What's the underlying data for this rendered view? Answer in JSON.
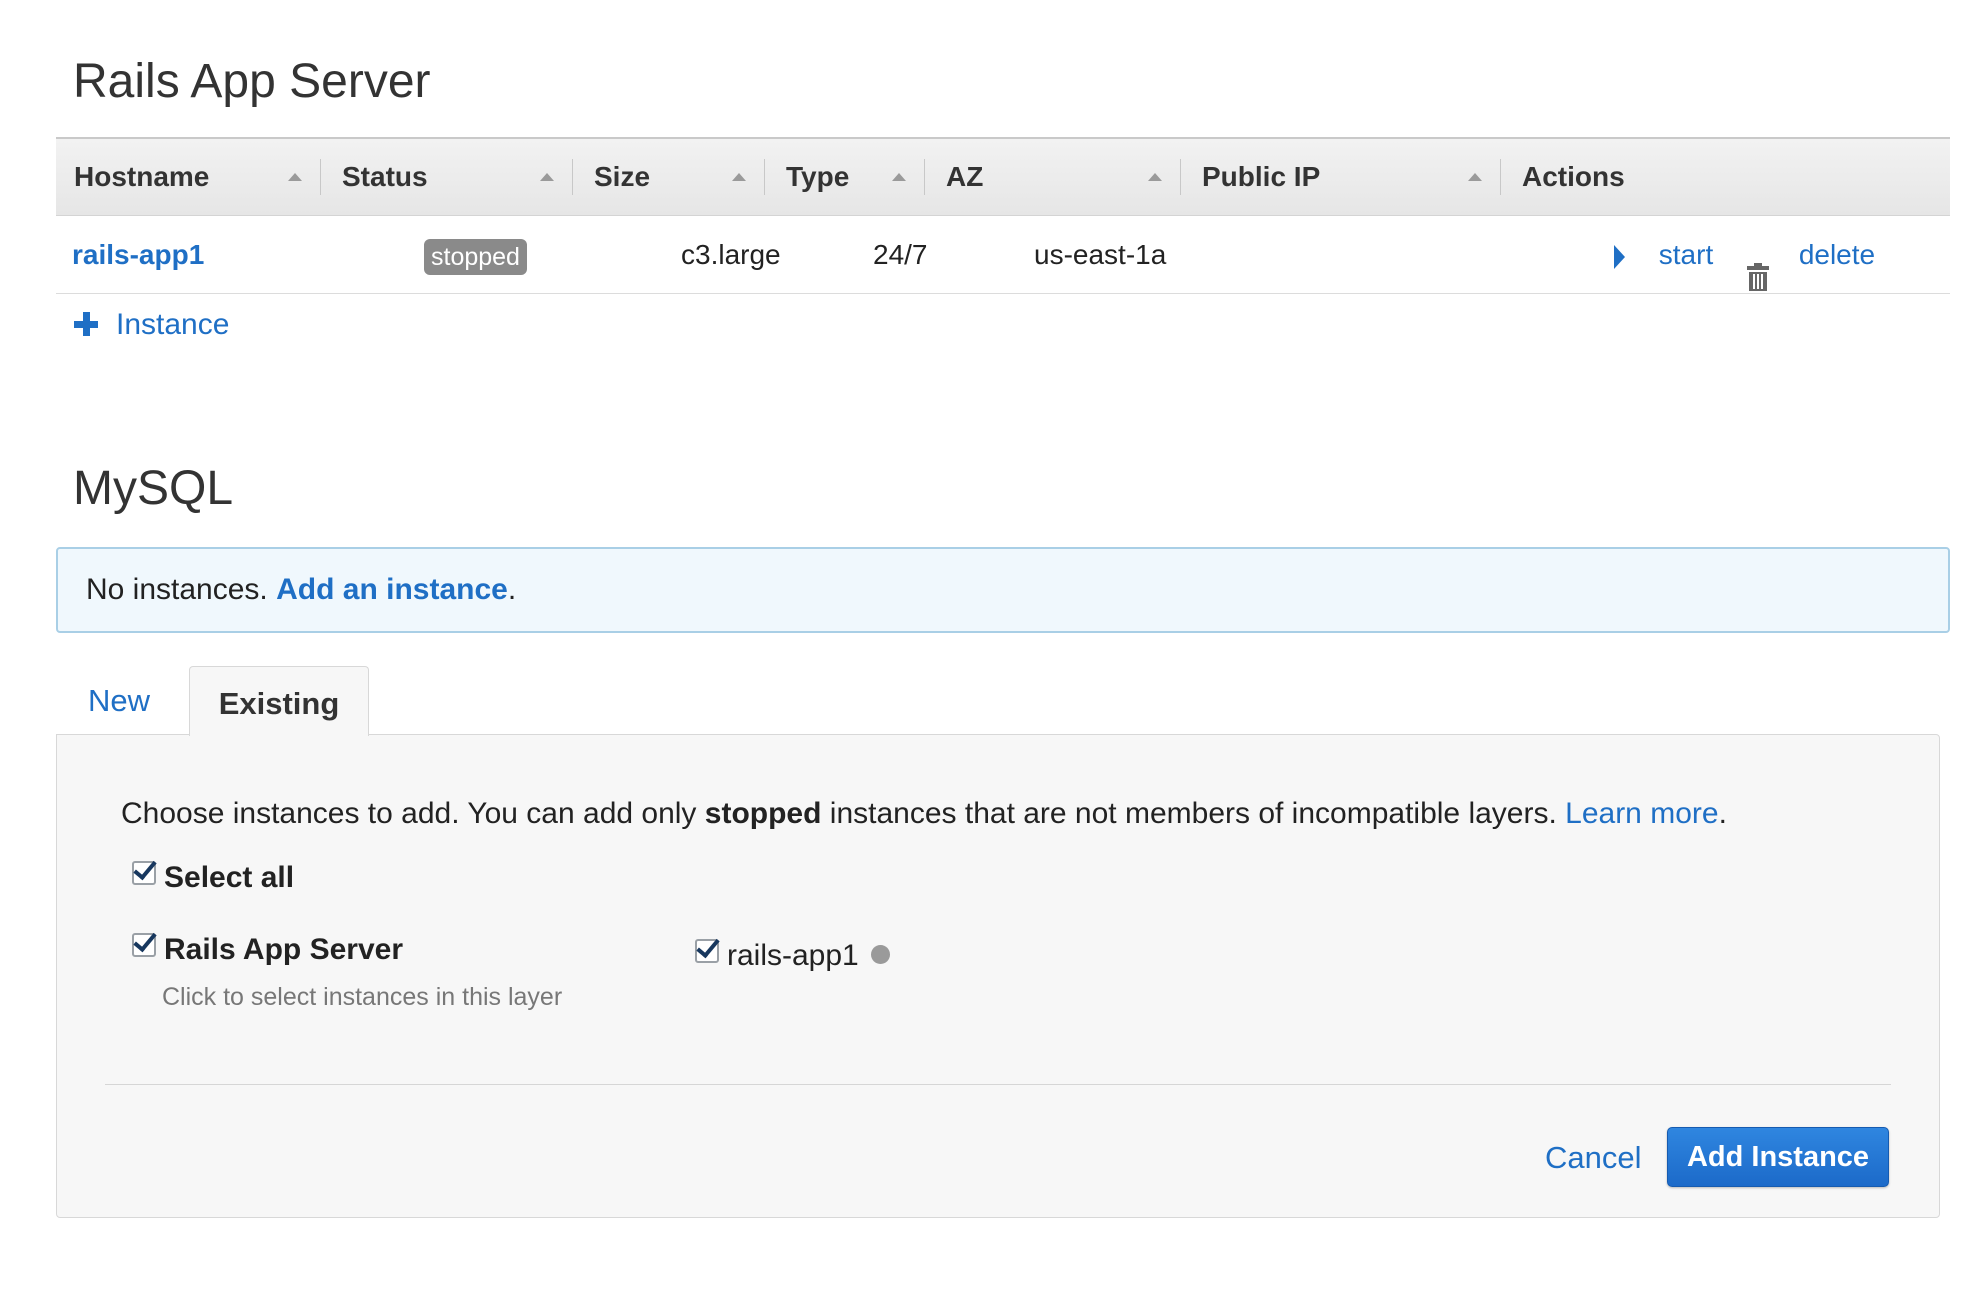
{
  "rails_section": {
    "title": "Rails App Server",
    "table": {
      "columns": [
        "Hostname",
        "Status",
        "Size",
        "Type",
        "AZ",
        "Public IP",
        "Actions"
      ],
      "rows": [
        {
          "hostname": "rails-app1",
          "status": "stopped",
          "size": "c3.large",
          "type": "24/7",
          "az": "us-east-1a",
          "public_ip": "",
          "actions": {
            "start": "start",
            "delete": "delete"
          }
        }
      ]
    },
    "add_instance_label": "Instance"
  },
  "mysql_section": {
    "title": "MySQL",
    "info": {
      "text": "No instances.",
      "link": "Add an instance",
      "suffix": "."
    },
    "tabs": [
      {
        "label": "New",
        "active": false
      },
      {
        "label": "Existing",
        "active": true
      }
    ],
    "panel": {
      "instructions": {
        "before": "Choose instances to add. You can add only ",
        "bold": "stopped",
        "after": " instances that are not members of incompatible layers. ",
        "link": "Learn more",
        "end": "."
      },
      "select_all": {
        "label": "Select all",
        "checked": true
      },
      "layer": {
        "label": "Rails App Server",
        "hint": "Click to select instances in this layer",
        "checked": true
      },
      "instance": {
        "label": "rails-app1",
        "checked": true
      },
      "cancel_label": "Cancel",
      "submit_label": "Add Instance"
    }
  },
  "colors": {
    "link": "#1f6fc5",
    "badge_stopped": "#8a8a8a",
    "primary_button": "#1c6ac9",
    "info_border": "#a9cfe6",
    "info_background": "#f0f8fd"
  }
}
